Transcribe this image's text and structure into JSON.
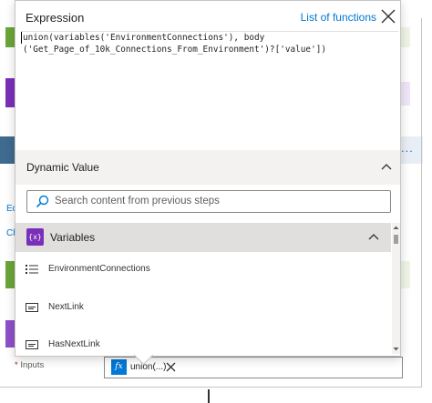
{
  "popup": {
    "title": "Expression",
    "functions_link": "List of functions",
    "expression_text": "union(variables('EnvironmentConnections'), body\n('Get_Page_of_10k_Connections_From_Environment')?['value'])"
  },
  "dynamic": {
    "title": "Dynamic Value",
    "search_placeholder": "Search content from previous steps"
  },
  "variables": {
    "badge": "{x}",
    "title": "Variables",
    "items": [
      {
        "label": "EnvironmentConnections",
        "icon": "array-icon"
      },
      {
        "label": "NextLink",
        "icon": "string-icon"
      },
      {
        "label": "HasNextLink",
        "icon": "string-icon"
      }
    ]
  },
  "background": {
    "left_text_1": "Ed",
    "left_text_2": "Ch",
    "more_dots": "..."
  },
  "inputs": {
    "required_mark": "*",
    "label": "Inputs",
    "token_fx": "fx",
    "token_label": "union(...)"
  },
  "colors": {
    "accent": "#0078d4",
    "variables_purple": "#7a2fb8",
    "action_green": "#6ba539"
  }
}
